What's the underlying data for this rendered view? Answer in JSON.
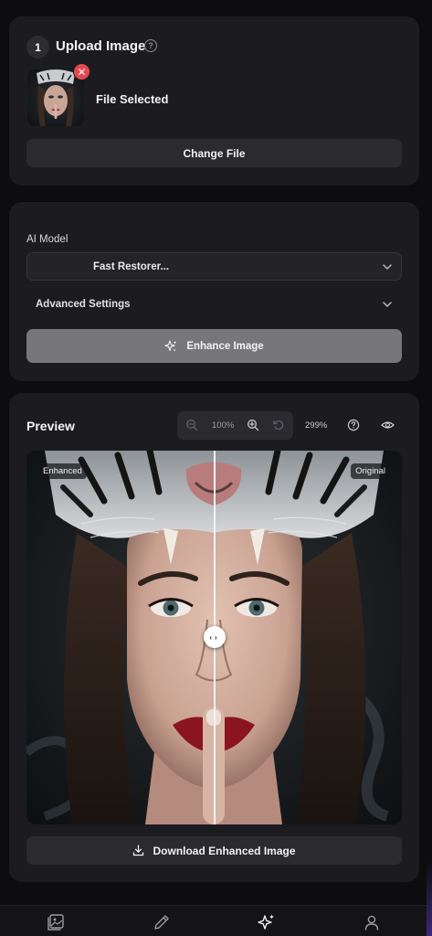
{
  "upload": {
    "step_number": "1",
    "title": "Upload Image",
    "help_symbol": "?",
    "remove_symbol": "✕",
    "file_status": "File Selected",
    "change_label": "Change File"
  },
  "settings": {
    "model_label": "AI Model",
    "model_value": "Fast Restorer...",
    "advanced_label": "Advanced Settings",
    "enhance_label": "Enhance Image"
  },
  "preview": {
    "title": "Preview",
    "zoom_level": "100%",
    "zoom_percent": "299%",
    "enhanced_tag": "Enhanced",
    "original_tag": "Original",
    "slider_position": 0.5,
    "download_label": "Download Enhanced Image"
  },
  "bottom_nav": {
    "items": [
      "gallery-icon",
      "pencil-icon",
      "sparkles-icon",
      "user-icon"
    ],
    "active_index": 2
  },
  "colors": {
    "background": "#0d0d10",
    "card": "#1c1c20",
    "button": "#2a2a2f",
    "enhance_button": "#77777b",
    "remove_badge": "#e5484d"
  }
}
